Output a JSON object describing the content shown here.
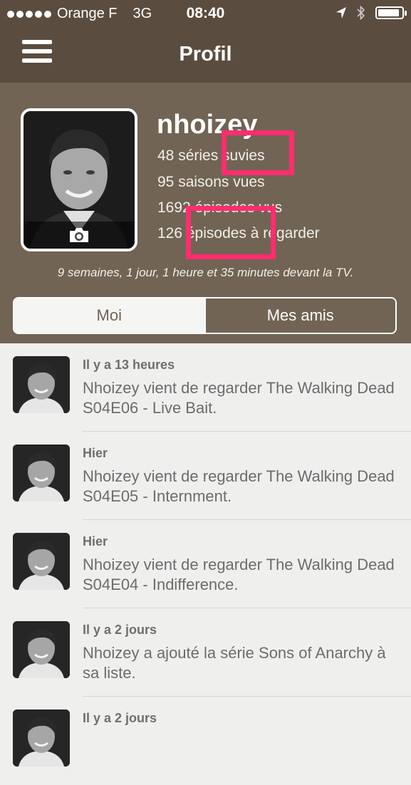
{
  "status_bar": {
    "carrier": "Orange F",
    "network": "3G",
    "time": "08:40",
    "battery_level": 0.9
  },
  "nav": {
    "title": "Profil",
    "menu_icon": "hamburger-icon"
  },
  "profile": {
    "username": "nhoizey",
    "stats": [
      "48 séries suvies",
      "95 saisons vues",
      "1692 épisodes vus",
      "126 épisodes à regarder"
    ],
    "tv_time": "9 semaines, 1 jour, 1 heure et 35 minutes devant la TV.",
    "camera_icon": "camera-icon"
  },
  "tabs": [
    {
      "label": "Moi",
      "active": true
    },
    {
      "label": "Mes amis",
      "active": false
    }
  ],
  "colors": {
    "header": "#5a4d3f",
    "profile_bg": "#716454",
    "highlight": "#ff2d6f",
    "feed_bg": "#efefee"
  },
  "feed": [
    {
      "when": "Il y a 13 heures",
      "text": "Nhoizey vient de regarder The Walking Dead S04E06 - Live Bait."
    },
    {
      "when": "Hier",
      "text": "Nhoizey vient de regarder The Walking Dead S04E05 - Internment."
    },
    {
      "when": "Hier",
      "text": "Nhoizey vient de regarder The Walking Dead S04E04 - Indifference."
    },
    {
      "when": "Il y a 2 jours",
      "text": "Nhoizey a ajouté la série Sons of Anarchy à sa liste."
    },
    {
      "when": "Il y a 2 jours",
      "text": ""
    }
  ]
}
